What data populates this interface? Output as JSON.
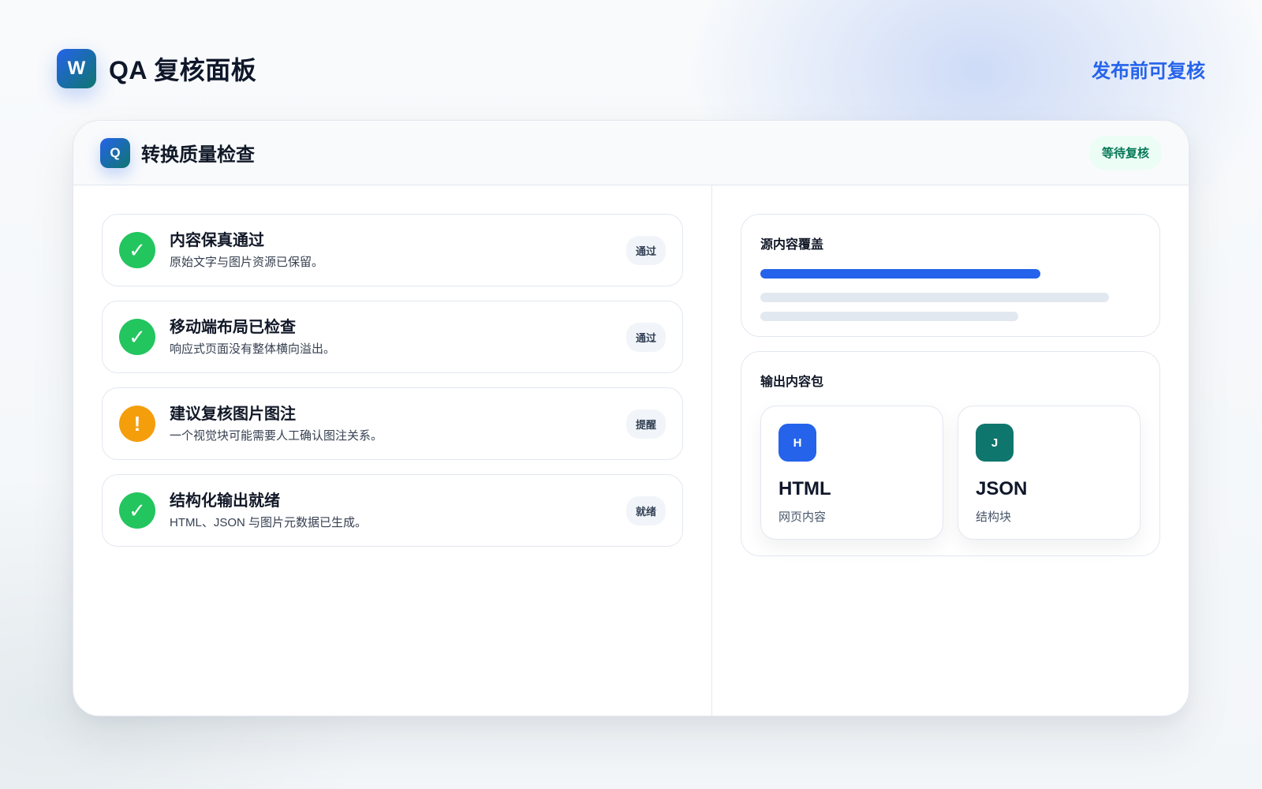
{
  "header": {
    "logo_letter": "W",
    "title": "QA 复核面板",
    "link_label": "发布前可复核"
  },
  "panel": {
    "icon_letter": "Q",
    "title": "转换质量检查",
    "status": "等待复核"
  },
  "checks": [
    {
      "icon": "checkmark-icon",
      "glyph": "✓",
      "state": "ok",
      "title": "内容保真通过",
      "description": "原始文字与图片资源已保留。",
      "tag": "通过"
    },
    {
      "icon": "checkmark-icon",
      "glyph": "✓",
      "state": "ok",
      "title": "移动端布局已检查",
      "description": "响应式页面没有整体横向溢出。",
      "tag": "通过"
    },
    {
      "icon": "warning-icon",
      "glyph": "!",
      "state": "warn",
      "title": "建议复核图片图注",
      "description": "一个视觉块可能需要人工确认图注关系。",
      "tag": "提醒"
    },
    {
      "icon": "checkmark-icon",
      "glyph": "✓",
      "state": "ok",
      "title": "结构化输出就绪",
      "description": "HTML、JSON 与图片元数据已生成。",
      "tag": "就绪"
    }
  ],
  "coverage": {
    "title": "源内容覆盖"
  },
  "output": {
    "title": "输出内容包",
    "items": [
      {
        "letter": "H",
        "name": "HTML",
        "description": "网页内容",
        "color": "#2563eb"
      },
      {
        "letter": "J",
        "name": "JSON",
        "description": "结构块",
        "color": "#0f766e"
      }
    ]
  },
  "colors": {
    "accent": "#2563eb",
    "success": "#22c55e",
    "warning": "#f59e0b",
    "teal": "#0f766e"
  }
}
